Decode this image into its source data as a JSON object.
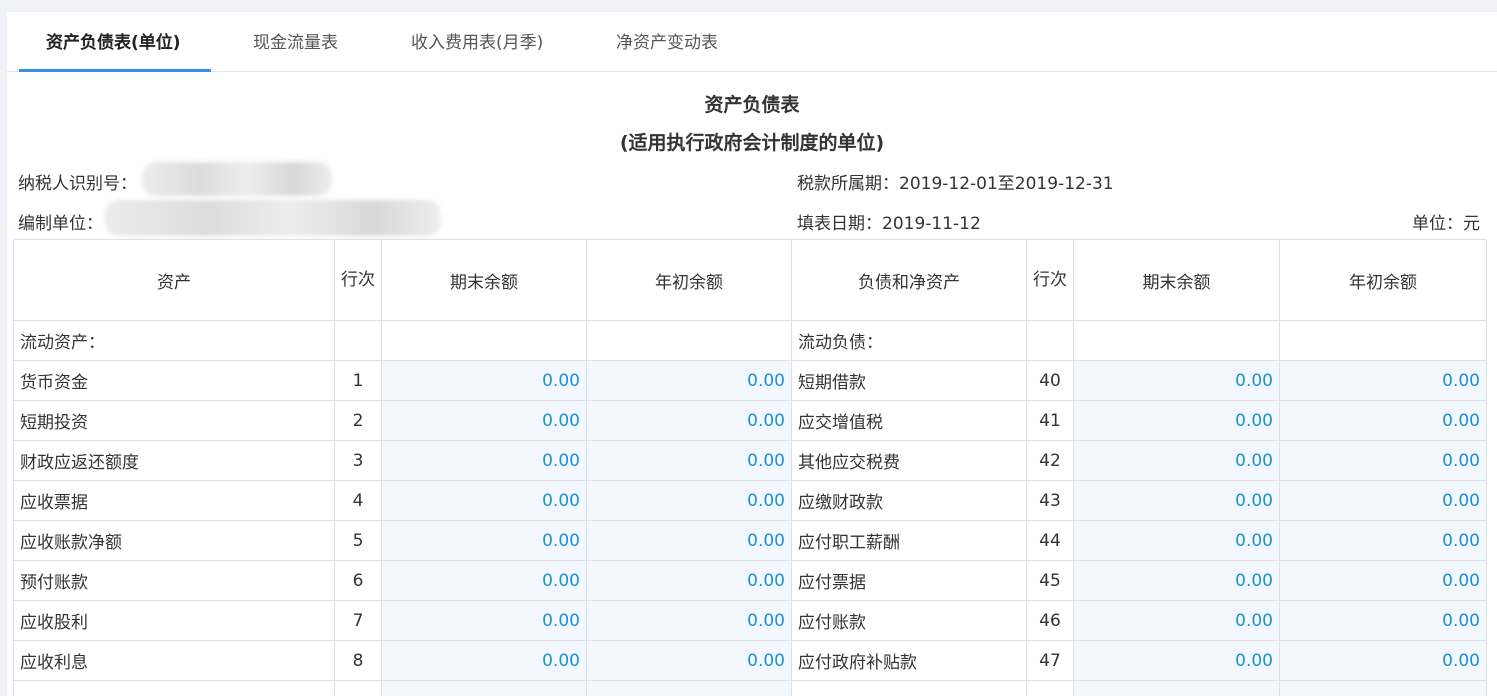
{
  "tabs": [
    {
      "label": "资产负债表(单位)",
      "active": true
    },
    {
      "label": "现金流量表",
      "active": false
    },
    {
      "label": "收入费用表(月季)",
      "active": false
    },
    {
      "label": "净资产变动表",
      "active": false
    }
  ],
  "report": {
    "title": "资产负债表",
    "subtitle": "(适用执行政府会计制度的单位)",
    "taxpayer_id_label": "纳税人识别号：",
    "tax_period_label": "税款所属期：2019-12-01至2019-12-31",
    "org_label": "编制单位：",
    "fill_date_label": "填表日期：2019-11-12",
    "unit_label": "单位：元"
  },
  "table": {
    "headers": {
      "assets": "资产",
      "row_no": "行次",
      "end_balance": "期末余额",
      "begin_balance": "年初余额",
      "liabilities": "负债和净资产",
      "row_no2": "行次",
      "end_balance2": "期末余额",
      "begin_balance2": "年初余额"
    },
    "section_left": "流动资产：",
    "section_right": "流动负债：",
    "rows": [
      {
        "left_item": "货币资金",
        "left_no": "1",
        "left_end": "0.00",
        "left_begin": "0.00",
        "right_item": "短期借款",
        "right_no": "40",
        "right_end": "0.00",
        "right_begin": "0.00"
      },
      {
        "left_item": "短期投资",
        "left_no": "2",
        "left_end": "0.00",
        "left_begin": "0.00",
        "right_item": "应交增值税",
        "right_no": "41",
        "right_end": "0.00",
        "right_begin": "0.00"
      },
      {
        "left_item": "财政应返还额度",
        "left_no": "3",
        "left_end": "0.00",
        "left_begin": "0.00",
        "right_item": "其他应交税费",
        "right_no": "42",
        "right_end": "0.00",
        "right_begin": "0.00"
      },
      {
        "left_item": "应收票据",
        "left_no": "4",
        "left_end": "0.00",
        "left_begin": "0.00",
        "right_item": "应缴财政款",
        "right_no": "43",
        "right_end": "0.00",
        "right_begin": "0.00"
      },
      {
        "left_item": "应收账款净额",
        "left_no": "5",
        "left_end": "0.00",
        "left_begin": "0.00",
        "right_item": "应付职工薪酬",
        "right_no": "44",
        "right_end": "0.00",
        "right_begin": "0.00"
      },
      {
        "left_item": "预付账款",
        "left_no": "6",
        "left_end": "0.00",
        "left_begin": "0.00",
        "right_item": "应付票据",
        "right_no": "45",
        "right_end": "0.00",
        "right_begin": "0.00"
      },
      {
        "left_item": "应收股利",
        "left_no": "7",
        "left_end": "0.00",
        "left_begin": "0.00",
        "right_item": "应付账款",
        "right_no": "46",
        "right_end": "0.00",
        "right_begin": "0.00"
      },
      {
        "left_item": "应收利息",
        "left_no": "8",
        "left_end": "0.00",
        "left_begin": "0.00",
        "right_item": "应付政府补贴款",
        "right_no": "47",
        "right_end": "0.00",
        "right_begin": "0.00"
      }
    ]
  },
  "colors": {
    "accent": "#3a8ee6",
    "amount_text": "#1e90d8",
    "amount_bg": "#f2f8fe",
    "border": "#dcdfe6"
  }
}
